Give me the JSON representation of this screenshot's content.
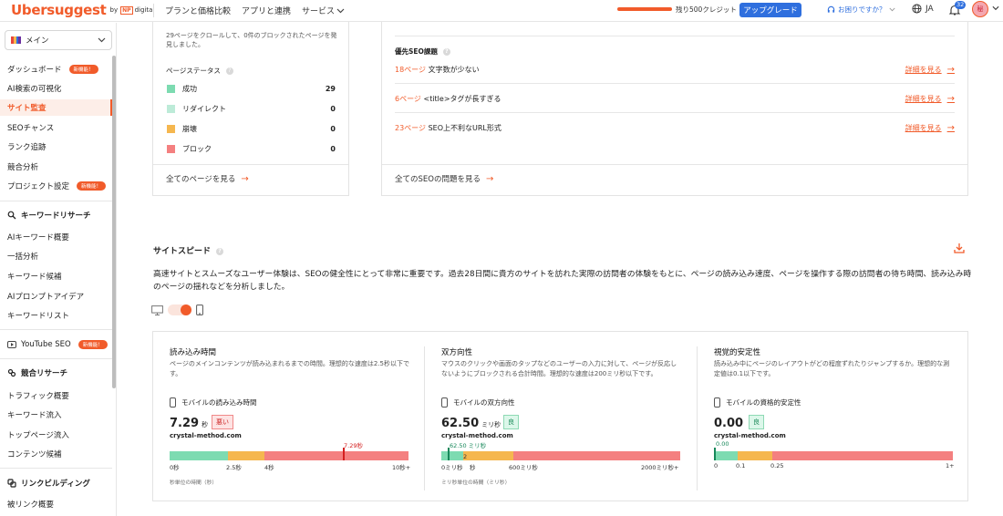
{
  "header": {
    "logo": "Ubersuggest",
    "logo_by": "by",
    "logo_np": "NP",
    "logo_digital": "digital",
    "nav": [
      "プランと価格比較",
      "アプリと連携",
      "サービス"
    ],
    "credits": "残り500クレジット",
    "upgrade": "アップグレード",
    "help": "お困りですか？",
    "lang": "JA",
    "notifications": "32",
    "avatar": "秘"
  },
  "sidebar": {
    "project": "メイン",
    "items": [
      {
        "label": "ダッシュボード",
        "badge": "新機能！"
      },
      {
        "label": "AI検索の可視化"
      },
      {
        "label": "サイト監査",
        "active": true
      },
      {
        "label": "SEOチャンス"
      },
      {
        "label": "ランク追跡"
      },
      {
        "label": "競合分析"
      },
      {
        "label": "プロジェクト設定",
        "badge": "新機能！"
      }
    ],
    "kw_head": "キーワードリサーチ",
    "kw_items": [
      "AIキーワード概要",
      "一括分析",
      "キーワード候補",
      "AIプロンプトアイデア",
      "キーワードリスト"
    ],
    "yt": {
      "label": "YouTube SEO",
      "badge": "新機能！"
    },
    "comp_head": "競合リサーチ",
    "comp_items": [
      "トラフィック概要",
      "キーワード流入",
      "トップページ流入",
      "コンテンツ候補"
    ],
    "link_head": "リンクビルディング",
    "link_items": [
      "被リンク概要"
    ]
  },
  "crawl_card": {
    "summary": "29ページをクロールして、0件のブロックされたページを発見しました。",
    "status_title": "ページステータス",
    "statuses": [
      {
        "label": "成功",
        "value": "29",
        "color": "#7ddbb1"
      },
      {
        "label": "リダイレクト",
        "value": "0",
        "color": "#bdebd8"
      },
      {
        "label": "崩壊",
        "value": "0",
        "color": "#f5b74f"
      },
      {
        "label": "ブロック",
        "value": "0",
        "color": "#f48080"
      }
    ],
    "view_all": "全てのページを見る"
  },
  "seo_card": {
    "title": "優先SEO課題",
    "issues": [
      {
        "count": "18ページ",
        "text": "文字数が少ない",
        "link": "詳細を見る"
      },
      {
        "count": "6ページ",
        "text": "<title>タグが長すぎる",
        "link": "詳細を見る"
      },
      {
        "count": "23ページ",
        "text": "SEO上不利なURL形式",
        "link": "詳細を見る"
      }
    ],
    "view_all": "全てのSEOの問題を見る"
  },
  "site_speed": {
    "title": "サイトスピード",
    "description": "高速サイトとスムーズなユーザー体験は、SEOの健全性にとって非常に重要です。過去28日間に貴方のサイトを訪れた実際の訪問者の体験をもとに、ページの読み込み速度、ページを操作する際の訪問者の待ち時間、読み込み時のページの揺れなどを分析しました。",
    "device": "mobile",
    "colors": {
      "good": "#7ddbb1",
      "mid": "#f5b74f",
      "bad": "#f48080",
      "marker_bad": "#d42020",
      "marker_good": "#17885a"
    },
    "metrics": [
      {
        "title": "読み込み時間",
        "desc": "ページのメインコンテンツが読み込まれるまでの時間。理想的な速度は2.5秒以下です。",
        "label": "モバイルの読み込み時間",
        "value": "7.29",
        "unit": "秒",
        "status": "悪い",
        "site": "crystal-method.com",
        "marker": "7.29秒",
        "ticks": [
          "0秒",
          "2.5秒",
          "4秒",
          "10秒+"
        ],
        "axis_note": "秒単位の時間（秒）"
      },
      {
        "title": "双方向性",
        "desc": "マウスのクリックや画面のタップなどのユーザーの入力に対して、ページが反応しないようにブロックされる合計時間。理想的な速度は200ミリ秒以下です。",
        "label": "モバイルの双方向性",
        "value": "62.50",
        "unit": "ミリ秒",
        "status": "良",
        "site": "crystal-method.com",
        "marker": "62.50 ミリ秒",
        "ticks": [
          "0ミリ秒",
          "2",
          "秒",
          "600ミリ秒",
          "2000ミリ秒+"
        ],
        "axis_note": "ミリ秒単位の時間（ミリ秒）"
      },
      {
        "title": "視覚的安定性",
        "desc": "読み込み中にページのレイアウトがどの程度ずれたりジャンプするか。理想的な測定値は0.1以下です。",
        "label": "モバイルの資格的安定性",
        "value": "0.00",
        "unit": "",
        "status": "良",
        "site": "crystal-method.com",
        "marker": "0.00",
        "ticks": [
          "0",
          "0.1",
          "0.25",
          "1+"
        ],
        "axis_note": ""
      }
    ]
  }
}
